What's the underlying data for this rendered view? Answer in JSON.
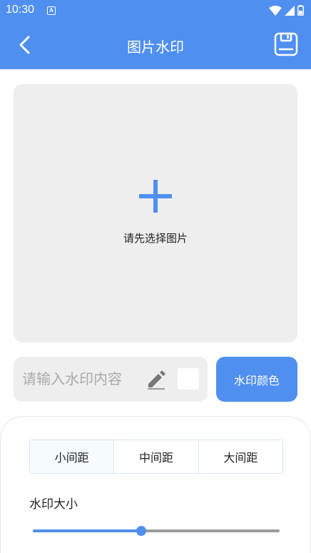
{
  "status_bar": {
    "time": "10:30",
    "notification_letter": "A",
    "icons": [
      "notification-icon",
      "wifi-icon",
      "signal-icon",
      "battery-icon"
    ]
  },
  "app_bar": {
    "title": "图片水印",
    "left_icon": "back-icon",
    "right_icon": "save-icon"
  },
  "image_picker": {
    "hint": "请先选择图片",
    "icon": "plus-icon"
  },
  "watermark": {
    "placeholder": "请输入水印内容",
    "value": "",
    "color_button": "水印颜色",
    "swatch_color": "#ffffff"
  },
  "spacing": {
    "options": [
      "小间距",
      "中间距",
      "大间距"
    ],
    "selected": "小间距"
  },
  "size": {
    "label": "水印大小",
    "value_fraction": 0.44
  },
  "colors": {
    "accent": "#4f8ff0",
    "panel_bg": "#eeeeee",
    "slider_track": "#9b9b9b"
  }
}
